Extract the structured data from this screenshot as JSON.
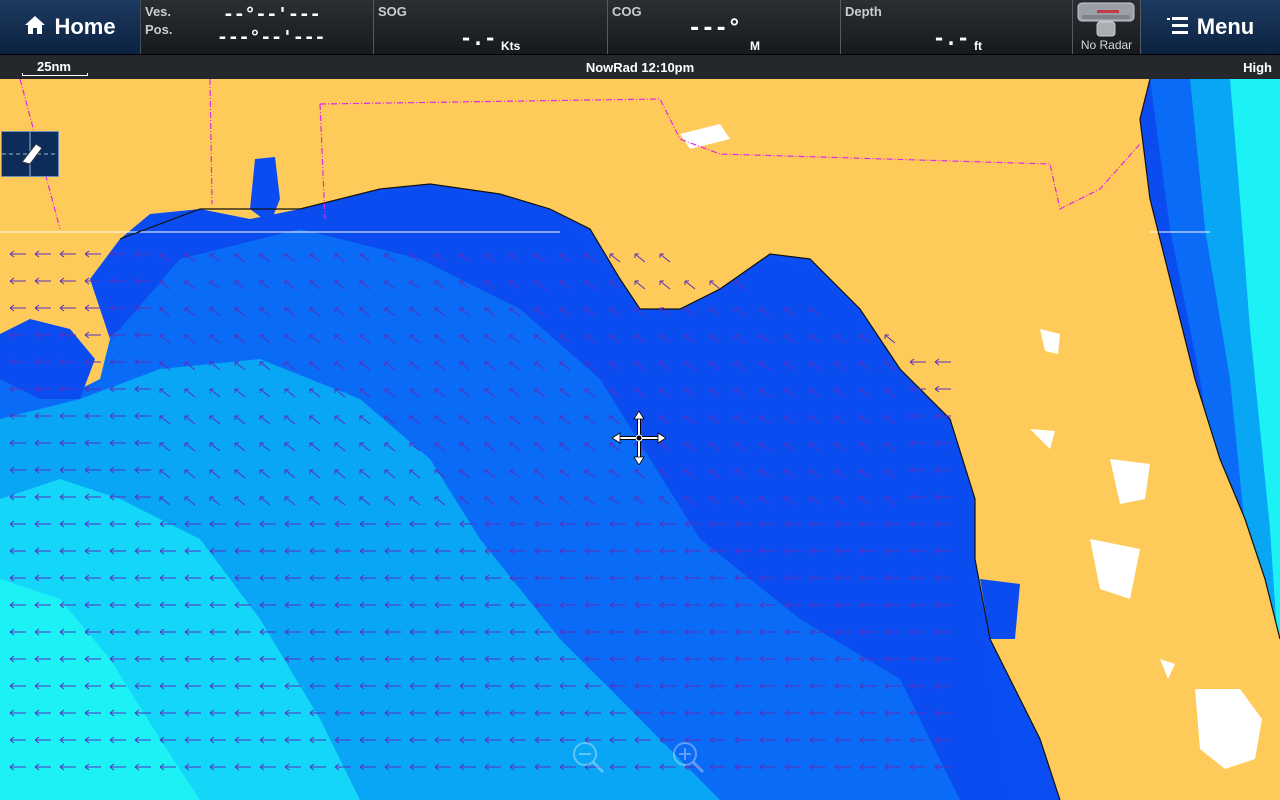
{
  "header": {
    "home_label": "Home",
    "menu_label": "Menu",
    "vessel_position": {
      "label_line1": "Ves.",
      "label_line2": "Pos.",
      "lat_value": "--°--'---",
      "lon_value": "---°--'---"
    },
    "sog": {
      "label": "SOG",
      "value": "-.-",
      "unit": "Kts"
    },
    "cog": {
      "label": "COG",
      "value": "---°",
      "unit": "M"
    },
    "depth": {
      "label": "Depth",
      "value": "-.-",
      "unit": "ft"
    },
    "radar": {
      "label": "No Radar"
    }
  },
  "status": {
    "scale": "25nm",
    "overlay": "NowRad 12:10pm",
    "detail_level": "High"
  },
  "icons": {
    "home": "home-icon",
    "menu": "menu-icon",
    "radar": "radar-icon",
    "boat": "boat-icon",
    "cursor": "crosshair-icon",
    "zoom_out": "zoom-out-icon",
    "zoom_in": "zoom-in-icon"
  },
  "colors": {
    "land": "#fecb5a",
    "sea_deep": "#0b4cf0",
    "sea_mid": "#0a6bf6",
    "sea_shallow": "#08a6f5",
    "sea_shelf": "#14d6f8",
    "sea_edge": "#1cf2f6",
    "border": "#e028e8",
    "wind_arrow": "#5a2fbf",
    "header_blue": "#0c2240"
  }
}
